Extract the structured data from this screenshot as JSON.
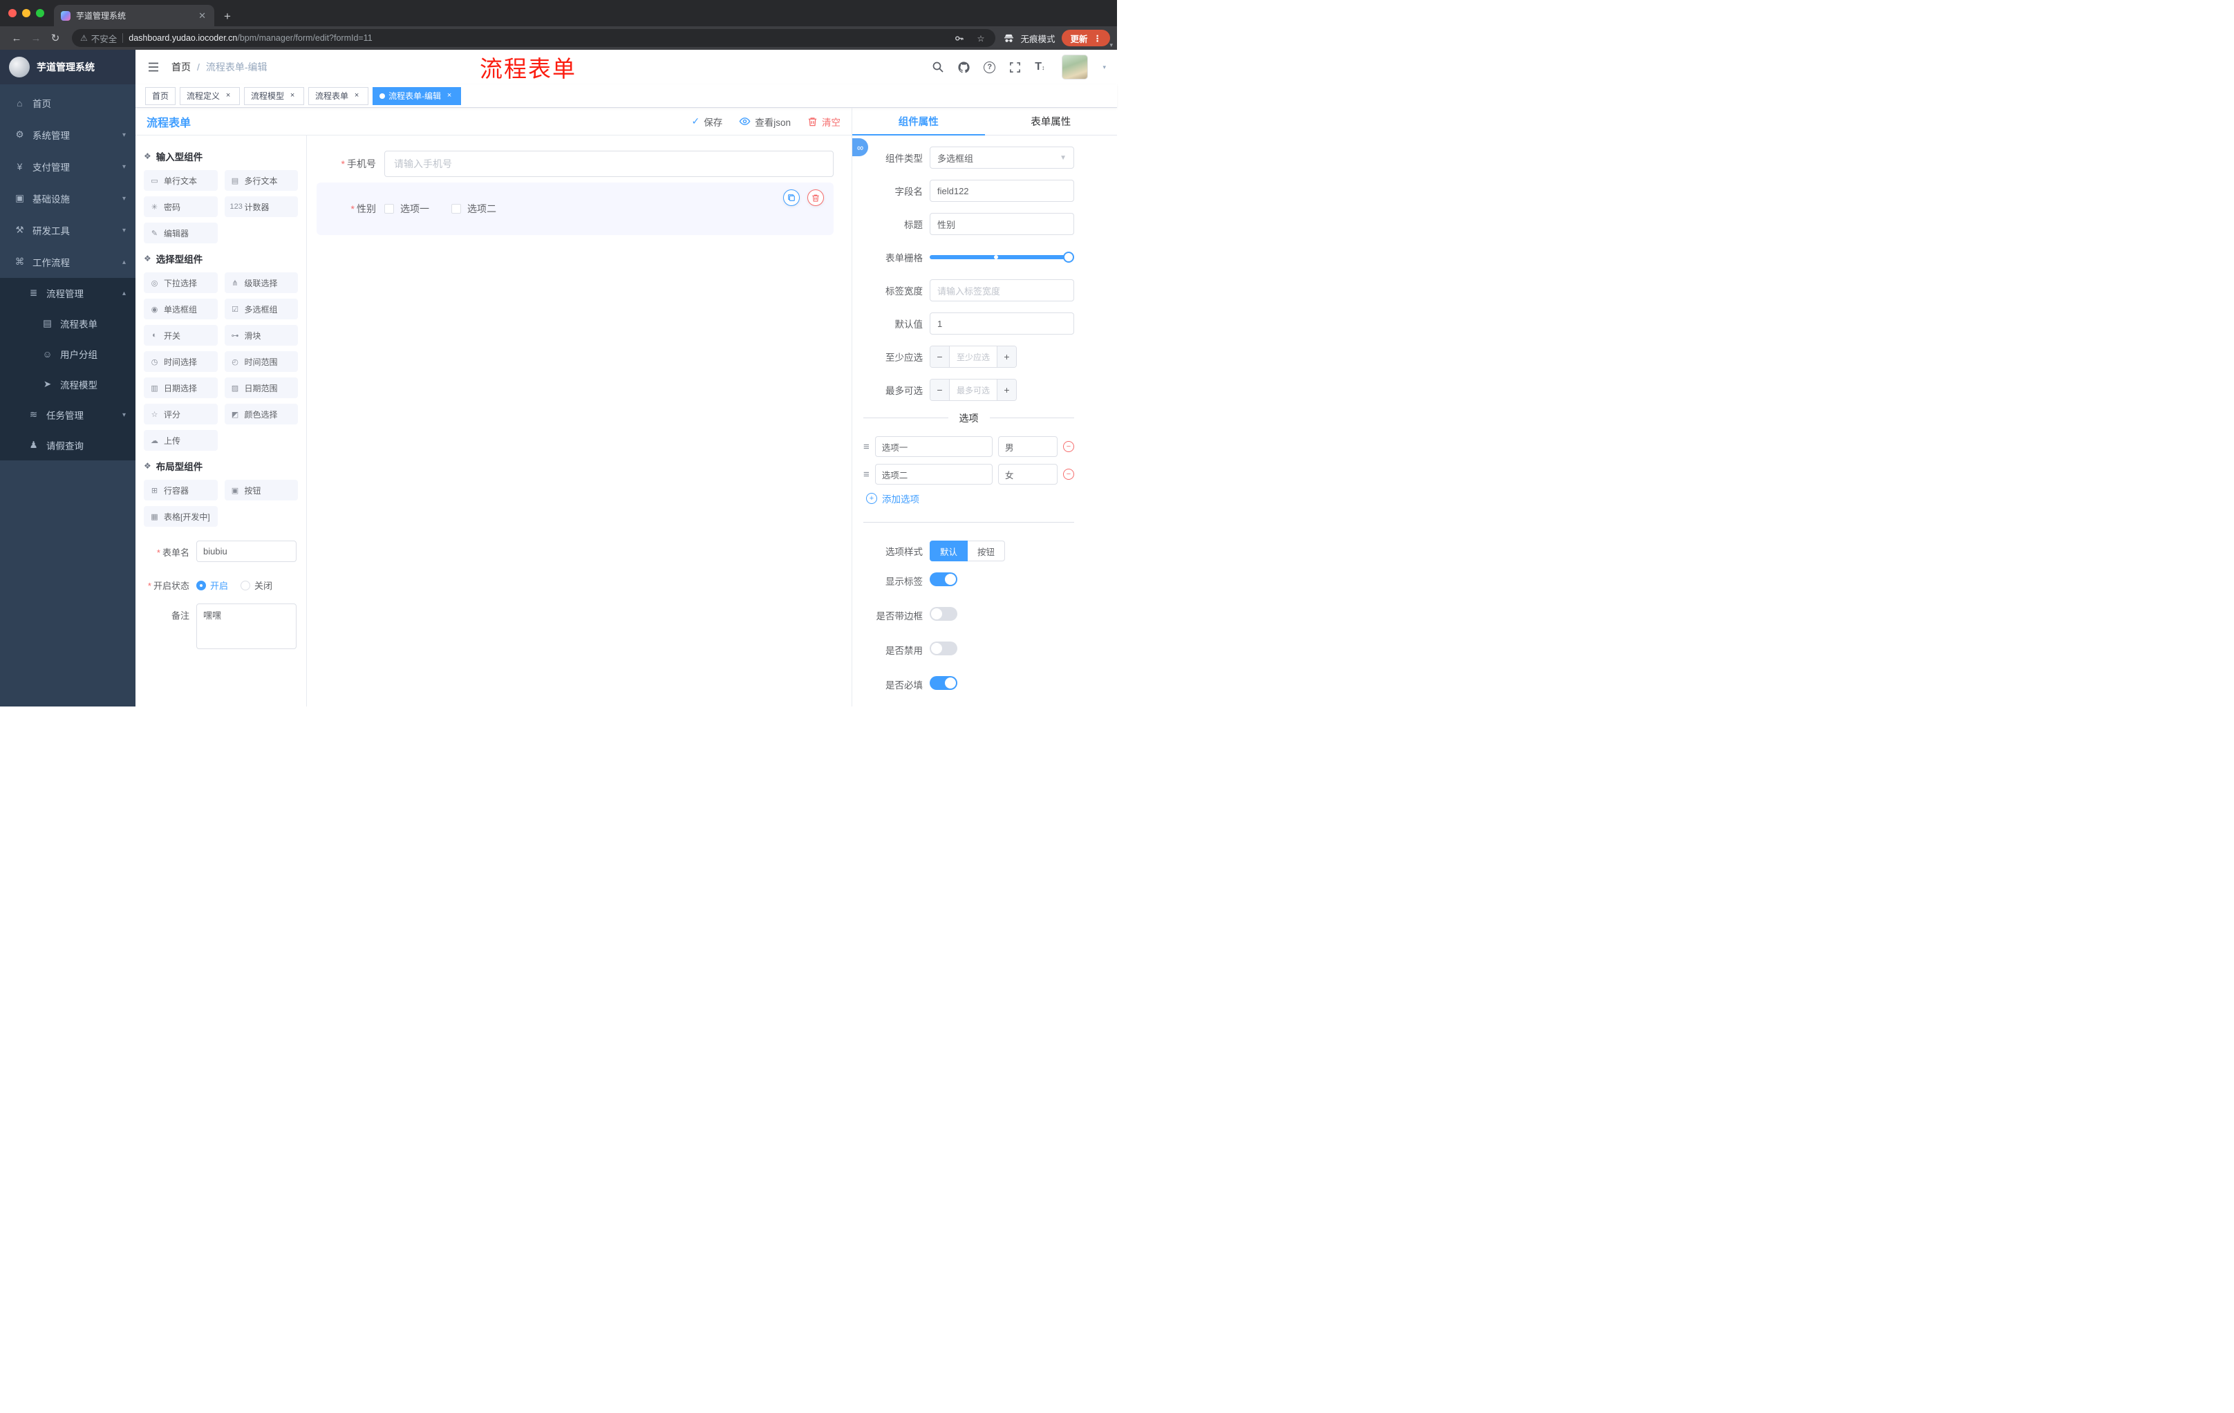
{
  "theme": {
    "accent": "#409EFF",
    "danger": "#F56C6C",
    "annotation_red": "#FB1D10",
    "sidebar_bg": "#304156",
    "submenu_bg": "#1F2D3D"
  },
  "browser": {
    "tab_title": "芋道管理系统",
    "security_label": "不安全",
    "url_domain": "dashboard.yudao.iocoder.cn",
    "url_path": "/bpm/manager/form/edit?formId=11",
    "incognito_label": "无痕模式",
    "update_label": "更新"
  },
  "sidebar": {
    "logo_title": "芋道管理系统",
    "items": [
      {
        "icon": "⌂",
        "label": "首页",
        "depth": 0,
        "arrow": "",
        "sub": false
      },
      {
        "icon": "⚙",
        "label": "系统管理",
        "depth": 0,
        "arrow": "▾",
        "sub": false
      },
      {
        "icon": "¥",
        "label": "支付管理",
        "depth": 0,
        "arrow": "▾",
        "sub": false
      },
      {
        "icon": "▣",
        "label": "基础设施",
        "depth": 0,
        "arrow": "▾",
        "sub": false
      },
      {
        "icon": "⚒",
        "label": "研发工具",
        "depth": 0,
        "arrow": "▾",
        "sub": false
      },
      {
        "icon": "⌘",
        "label": "工作流程",
        "depth": 0,
        "arrow": "▴",
        "sub": false
      },
      {
        "icon": "≣",
        "label": "流程管理",
        "depth": 1,
        "arrow": "▴",
        "sub": true
      },
      {
        "icon": "▤",
        "label": "流程表单",
        "depth": 2,
        "arrow": "",
        "sub": true
      },
      {
        "icon": "☺",
        "label": "用户分组",
        "depth": 2,
        "arrow": "",
        "sub": true
      },
      {
        "icon": "➤",
        "label": "流程模型",
        "depth": 2,
        "arrow": "",
        "sub": true
      },
      {
        "icon": "≋",
        "label": "任务管理",
        "depth": 1,
        "arrow": "▾",
        "sub": true
      },
      {
        "icon": "♟",
        "label": "请假查询",
        "depth": 1,
        "arrow": "",
        "sub": true
      }
    ]
  },
  "header": {
    "breadcrumb_home": "首页",
    "breadcrumb_sep": "/",
    "breadcrumb_current": "流程表单-编辑",
    "annotation": "流程表单"
  },
  "tags": [
    {
      "label": "首页",
      "active": false,
      "closable": false
    },
    {
      "label": "流程定义",
      "active": false,
      "closable": true
    },
    {
      "label": "流程模型",
      "active": false,
      "closable": true
    },
    {
      "label": "流程表单",
      "active": false,
      "closable": true
    },
    {
      "label": "流程表单-编辑",
      "active": true,
      "closable": true
    }
  ],
  "designer": {
    "title": "流程表单",
    "toolbar": {
      "save": "保存",
      "view_json": "查看json",
      "clear": "清空"
    },
    "palette": {
      "sections": [
        {
          "icon": "❖",
          "title": "输入型组件",
          "items": [
            {
              "icon": "▭",
              "label": "单行文本"
            },
            {
              "icon": "▤",
              "label": "多行文本"
            },
            {
              "icon": "✳",
              "label": "密码"
            },
            {
              "icon": "123",
              "label": "计数器"
            },
            {
              "icon": "✎",
              "label": "编辑器"
            }
          ]
        },
        {
          "icon": "❖",
          "title": "选择型组件",
          "items": [
            {
              "icon": "◎",
              "label": "下拉选择"
            },
            {
              "icon": "⋔",
              "label": "级联选择"
            },
            {
              "icon": "◉",
              "label": "单选框组"
            },
            {
              "icon": "☑",
              "label": "多选框组"
            },
            {
              "icon": "◐",
              "label": "开关"
            },
            {
              "icon": "⊶",
              "label": "滑块"
            },
            {
              "icon": "◷",
              "label": "时间选择"
            },
            {
              "icon": "◴",
              "label": "时间范围"
            },
            {
              "icon": "▥",
              "label": "日期选择"
            },
            {
              "icon": "▨",
              "label": "日期范围"
            },
            {
              "icon": "☆",
              "label": "评分"
            },
            {
              "icon": "◩",
              "label": "颜色选择"
            },
            {
              "icon": "☁",
              "label": "上传"
            }
          ]
        },
        {
          "icon": "❖",
          "title": "布局型组件",
          "items": [
            {
              "icon": "⊞",
              "label": "行容器"
            },
            {
              "icon": "▣",
              "label": "按钮"
            },
            {
              "icon": "▦",
              "label": "表格[开发中]"
            }
          ]
        }
      ]
    },
    "meta_form": {
      "form_name": {
        "label": "表单名",
        "value": "biubiu"
      },
      "status": {
        "label": "开启状态",
        "options": [
          "开启",
          "关闭"
        ],
        "selected": "开启"
      },
      "remark": {
        "label": "备注",
        "value": "嘿嘿"
      }
    },
    "canvas": {
      "phone": {
        "label": "手机号",
        "placeholder": "请输入手机号"
      },
      "gender": {
        "label": "性别",
        "options": [
          "选项一",
          "选项二"
        ]
      }
    }
  },
  "properties": {
    "tabs": {
      "component": "组件属性",
      "form": "表单属性"
    },
    "component_type": {
      "label": "组件类型",
      "value": "多选框组"
    },
    "field_name": {
      "label": "字段名",
      "value": "field122"
    },
    "title": {
      "label": "标题",
      "value": "性别"
    },
    "grid": {
      "label": "表单栅格"
    },
    "label_width": {
      "label": "标签宽度",
      "placeholder": "请输入标签宽度"
    },
    "default_value": {
      "label": "默认值",
      "value": "1"
    },
    "min_select": {
      "label": "至少应选",
      "placeholder": "至少应选"
    },
    "max_select": {
      "label": "最多可选",
      "placeholder": "最多可选"
    },
    "options_title": "选项",
    "options": [
      {
        "label": "选项一",
        "value": "男"
      },
      {
        "label": "选项二",
        "value": "女"
      }
    ],
    "add_option": "添加选项",
    "option_style": {
      "label": "选项样式",
      "options": [
        "默认",
        "按钮"
      ],
      "selected": "默认"
    },
    "switches": [
      {
        "label": "显示标签",
        "on": true
      },
      {
        "label": "是否带边框",
        "on": false
      },
      {
        "label": "是否禁用",
        "on": false
      },
      {
        "label": "是否必填",
        "on": true
      }
    ]
  }
}
